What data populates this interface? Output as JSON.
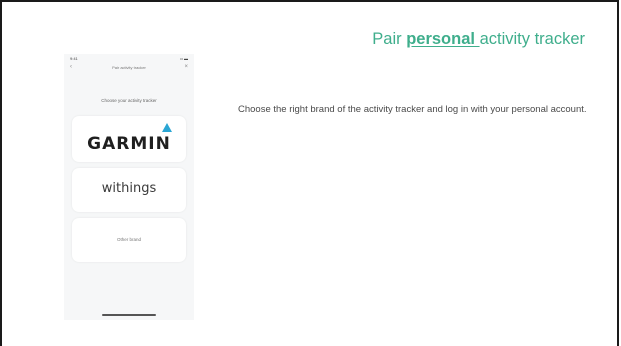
{
  "slide": {
    "title_prefix": "Pair ",
    "title_emph": "personal ",
    "title_suffix": "activity tracker",
    "description": "Choose the right brand of the activity tracker and log in with your personal account."
  },
  "phone": {
    "status_time": "9:41",
    "status_signal": "•• ▬",
    "back_glyph": "‹",
    "screen_title": "Pair activity tracker",
    "close_glyph": "×",
    "prompt": "Choose your activity tracker",
    "brands": {
      "garmin": "GARMIN",
      "withings": "withings",
      "other": "Other brand"
    }
  },
  "colors": {
    "accent": "#3fae8c",
    "garmin_triangle": "#2aa6d4"
  }
}
